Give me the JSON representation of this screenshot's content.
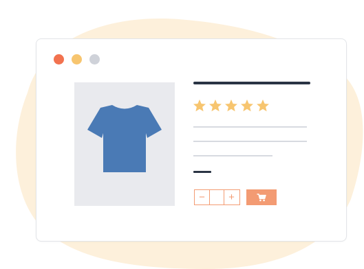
{
  "colors": {
    "background_blob": "#fdf0db",
    "window_bg": "#ffffff",
    "window_border": "#e2e4e8",
    "dot_close": "#f2724f",
    "dot_minimize": "#f7c56f",
    "dot_maximize": "#cfd2d9",
    "image_bg": "#e9eaee",
    "tshirt": "#4a7ab5",
    "title_bar": "#2a3444",
    "star": "#f7c56f",
    "text_line": "#d7dae0",
    "price_bar": "#2a3444",
    "accent": "#f39b73"
  },
  "icons": {
    "window_controls": [
      "close-dot",
      "minimize-dot",
      "maximize-dot"
    ],
    "product": "tshirt-icon",
    "rating": "star-icon",
    "cart": "cart-icon"
  },
  "rating": {
    "stars_filled": 5,
    "stars_total": 5
  },
  "stepper": {
    "minus_label": "−",
    "value": "",
    "plus_label": "+"
  }
}
